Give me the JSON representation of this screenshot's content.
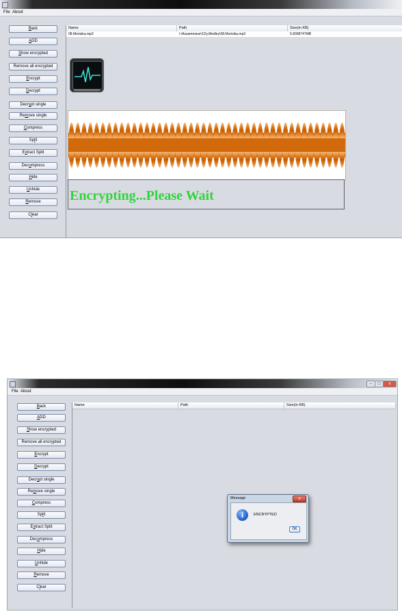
{
  "menu": {
    "file": "File",
    "about": "About"
  },
  "sidebar_buttons": [
    {
      "pre": "",
      "ul": "B",
      "post": "ack"
    },
    {
      "pre": "",
      "ul": "A",
      "post": "DD"
    },
    {
      "pre": "",
      "ul": "S",
      "post": "how encrypted"
    },
    {
      "pre": "Remove all encrypted",
      "ul": "",
      "post": ""
    },
    {
      "pre": "",
      "ul": "E",
      "post": "ncrypt"
    },
    {
      "pre": "",
      "ul": "D",
      "post": "ecrypt"
    },
    {
      "pre": "Decr",
      "ul": "y",
      "post": "pt single"
    },
    {
      "pre": "Re",
      "ul": "m",
      "post": "ove single"
    },
    {
      "pre": "",
      "ul": "C",
      "post": "ompress"
    },
    {
      "pre": "Sp",
      "ul": "l",
      "post": "it"
    },
    {
      "pre": "E",
      "ul": "x",
      "post": "tract Split"
    },
    {
      "pre": "Dec",
      "ul": "o",
      "post": "mpress"
    },
    {
      "pre": "",
      "ul": "H",
      "post": "ide"
    },
    {
      "pre": "",
      "ul": "U",
      "post": "nhide"
    },
    {
      "pre": "",
      "ul": "R",
      "post": "emove"
    },
    {
      "pre": "C",
      "ul": "l",
      "post": "ear"
    }
  ],
  "table": {
    "headers": [
      "Name",
      "Path",
      "Size(in KB)"
    ],
    "rows": [
      [
        "08.Morisika.mp3",
        "I:\\Assammese\\1Dy.Medley\\08.Morisika.mp3",
        "5.8008747MB"
      ]
    ]
  },
  "status_text": "Encrypting...Please Wait",
  "dialog": {
    "title": "Message",
    "message": "ENCRYPTED",
    "ok": "OK"
  },
  "colors": {
    "status_green": "#31d43a",
    "waveform_orange": "#d9700f"
  },
  "icons": [
    "monitor-icon",
    "info-icon",
    "close-icon"
  ]
}
